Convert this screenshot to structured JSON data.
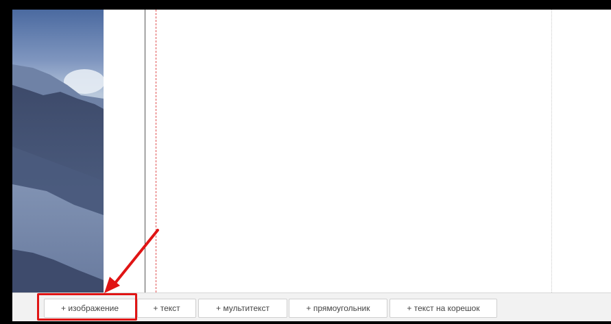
{
  "toolbar": {
    "buttons": [
      {
        "label": "+ изображение"
      },
      {
        "label": "+ текст"
      },
      {
        "label": "+ мультитекст"
      },
      {
        "label": "+ прямоугольник"
      },
      {
        "label": "+ текст на корешок"
      }
    ]
  },
  "colors": {
    "highlight": "#e01414",
    "bleed_guide": "#e05050",
    "toolbar_bg": "#f2f2f2",
    "frame": "#000000"
  },
  "icons": {
    "annotation_arrow": "arrow-down-left-icon",
    "cover_photo": "mountain-landscape-image"
  }
}
